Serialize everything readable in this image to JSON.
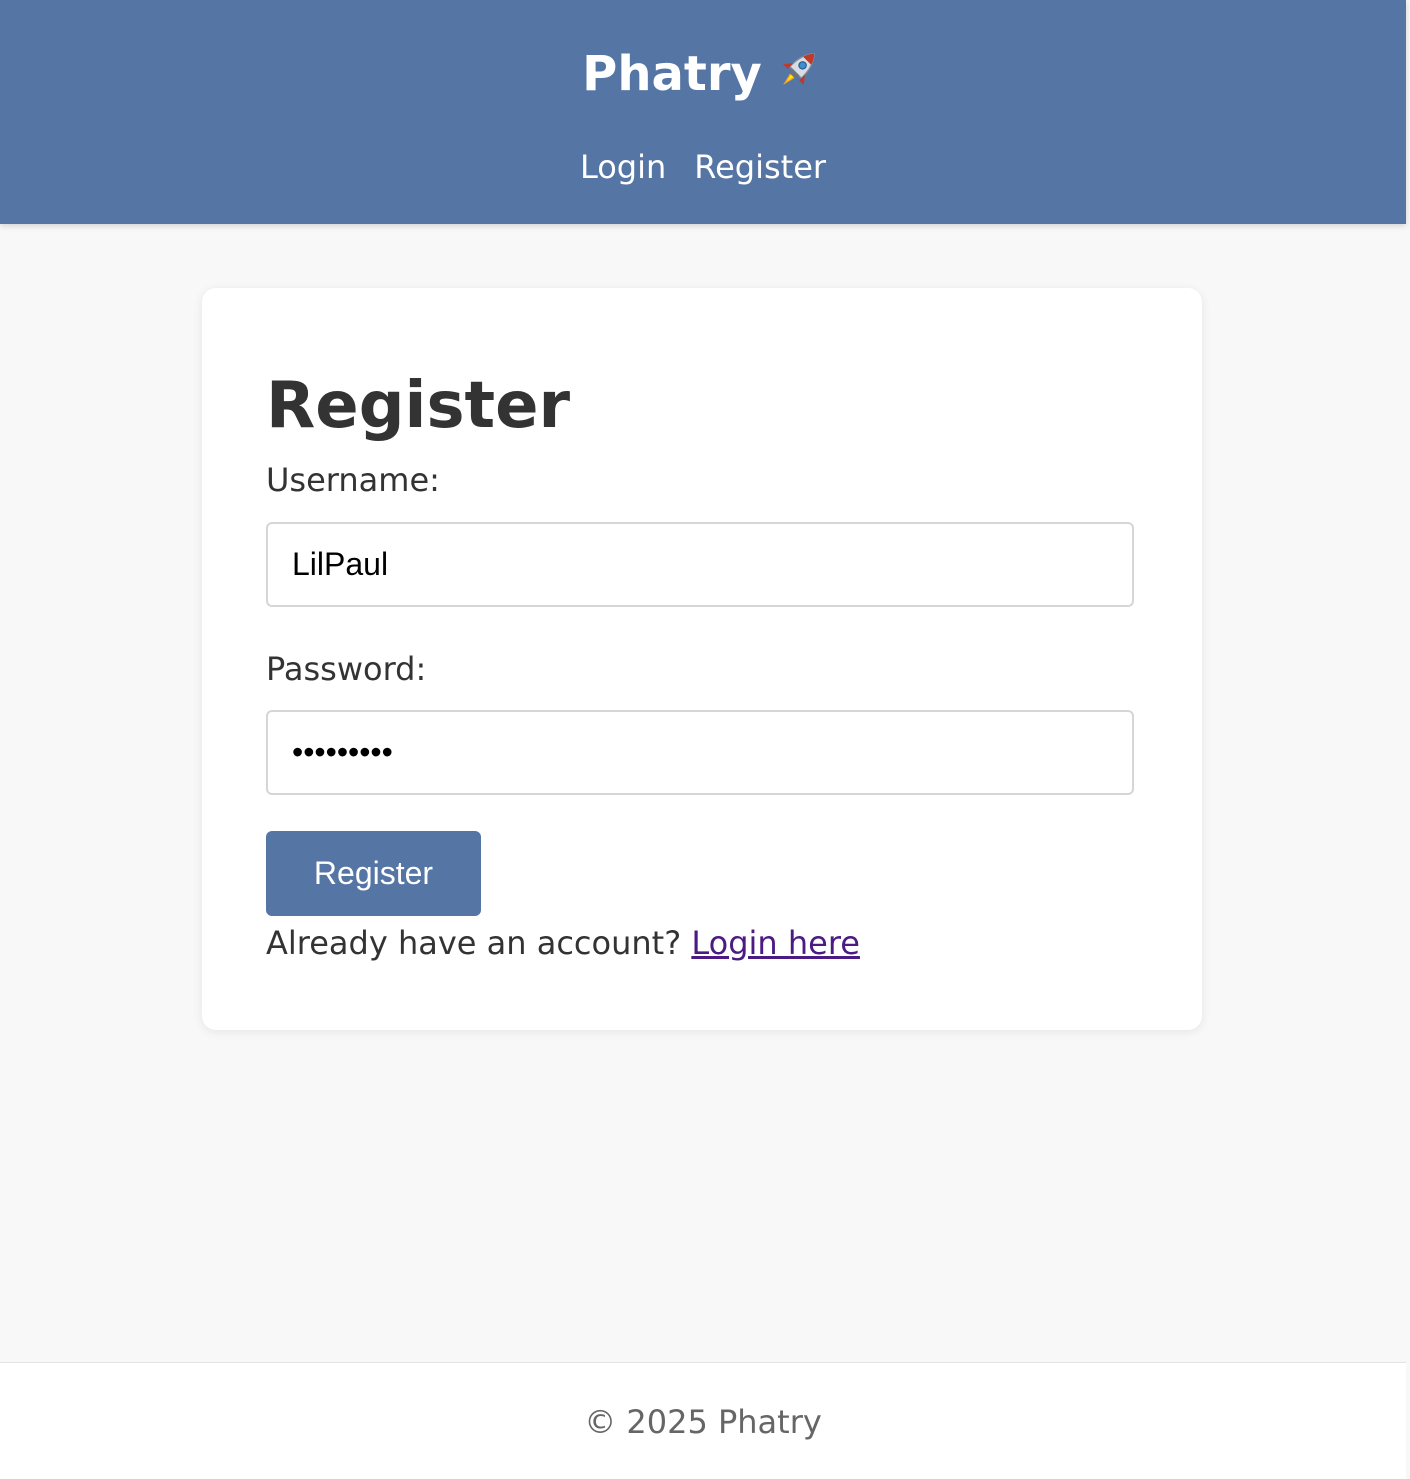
{
  "header": {
    "brand": "Phatry",
    "nav": {
      "login": "Login",
      "register": "Register"
    },
    "colors": {
      "background": "#5575a4",
      "text": "#ffffff"
    },
    "brand_icon": "rocket-icon"
  },
  "form": {
    "title": "Register",
    "username_label": "Username:",
    "username_value": "LilPaul",
    "password_label": "Password:",
    "password_value": "•••••••••",
    "submit_label": "Register",
    "footer_text": "Already have an account? ",
    "login_link": "Login here"
  },
  "footer": {
    "copyright": "© 2025 Phatry"
  }
}
